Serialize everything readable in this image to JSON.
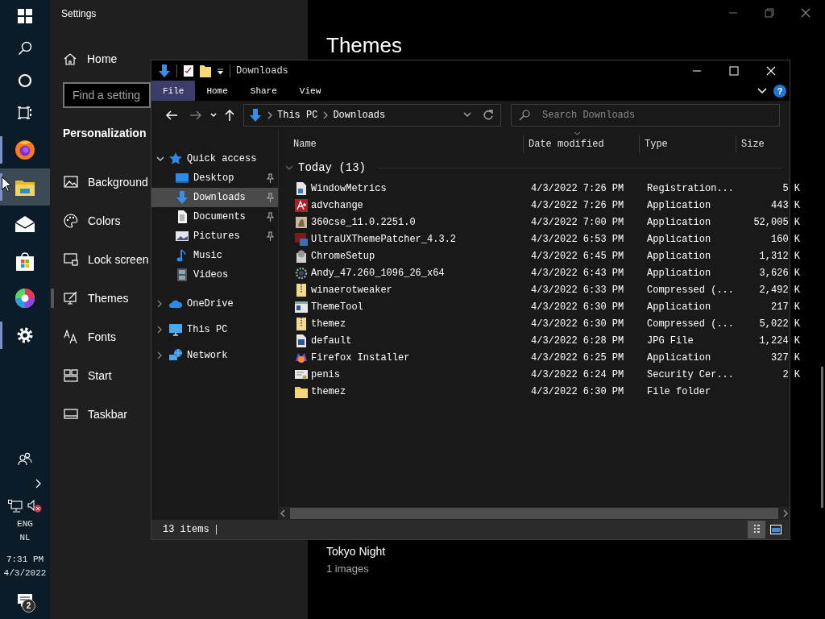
{
  "taskbar": {
    "items": [
      {
        "kind": "start",
        "running": false,
        "selected": false
      },
      {
        "kind": "search",
        "running": false,
        "selected": false
      },
      {
        "kind": "cortana",
        "running": false,
        "selected": false
      },
      {
        "kind": "taskview",
        "running": false,
        "selected": false
      },
      {
        "kind": "firefox",
        "running": true,
        "selected": false
      },
      {
        "kind": "explorer",
        "running": true,
        "selected": true
      },
      {
        "kind": "mail",
        "running": false,
        "selected": false
      },
      {
        "kind": "store",
        "running": false,
        "selected": false
      },
      {
        "kind": "photos",
        "running": false,
        "selected": false
      },
      {
        "kind": "settings",
        "running": true,
        "selected": false
      }
    ],
    "tray": {
      "language": "ENG",
      "region": "NL",
      "time": "7:31 PM",
      "date": "4/3/2022",
      "notifications": "2"
    }
  },
  "settings": {
    "title": "Settings",
    "home": "Home",
    "search": {
      "placeholder": "Find a setting"
    },
    "section": "Personalization",
    "nav": [
      {
        "kind": "background",
        "label": "Background",
        "selected": false
      },
      {
        "kind": "colors",
        "label": "Colors",
        "selected": false
      },
      {
        "kind": "lockscreen",
        "label": "Lock screen",
        "selected": false
      },
      {
        "kind": "themes",
        "label": "Themes",
        "selected": true
      },
      {
        "kind": "fonts",
        "label": "Fonts",
        "selected": false
      },
      {
        "kind": "start",
        "label": "Start",
        "selected": false
      },
      {
        "kind": "taskbar",
        "label": "Taskbar",
        "selected": false
      }
    ],
    "page_title": "Themes",
    "theme": {
      "name": "Tokyo Night",
      "count": "1 images"
    }
  },
  "explorer": {
    "title": "Downloads",
    "ribbon_tabs": [
      {
        "label": "File",
        "selected": true
      },
      {
        "label": "Home",
        "selected": false
      },
      {
        "label": "Share",
        "selected": false
      },
      {
        "label": "View",
        "selected": false
      }
    ],
    "help": "?",
    "address": [
      "This PC",
      "Downloads"
    ],
    "search": {
      "placeholder": "Search Downloads"
    },
    "tree": [
      {
        "kind": "quick",
        "label": "Quick access",
        "expanded": true,
        "selected": false,
        "children": [
          {
            "kind": "desktop",
            "label": "Desktop",
            "pinned": true,
            "selected": false
          },
          {
            "kind": "downloads",
            "label": "Downloads",
            "pinned": true,
            "selected": true
          },
          {
            "kind": "documents",
            "label": "Documents",
            "pinned": true,
            "selected": false
          },
          {
            "kind": "pictures",
            "label": "Pictures",
            "pinned": true,
            "selected": false
          },
          {
            "kind": "music",
            "label": "Music",
            "pinned": false,
            "selected": false
          },
          {
            "kind": "videos",
            "label": "Videos",
            "pinned": false,
            "selected": false
          }
        ]
      },
      {
        "kind": "cloud",
        "label": "OneDrive",
        "expanded": false,
        "selected": false
      },
      {
        "kind": "pc",
        "label": "This PC",
        "expanded": false,
        "selected": false
      },
      {
        "kind": "network",
        "label": "Network",
        "expanded": false,
        "selected": false
      }
    ],
    "columns": [
      "Name",
      "Date modified",
      "Type",
      "Size"
    ],
    "group": {
      "label": "Today (13)",
      "expanded": true
    },
    "rows": [
      {
        "kind": "registry",
        "name": "WindowMetrics",
        "date": "4/3/2022 7:26 PM",
        "type": "Registration...",
        "size": "5 K"
      },
      {
        "kind": "redapp",
        "name": "advchange",
        "date": "4/3/2022 7:26 PM",
        "type": "Application",
        "size": "443 K"
      },
      {
        "kind": "app",
        "name": "360cse_11.0.2251.0",
        "date": "4/3/2022 7:00 PM",
        "type": "Application",
        "size": "52,005 K"
      },
      {
        "kind": "patcher",
        "name": "UltraUXThemePatcher_4.3.2",
        "date": "4/3/2022 6:53 PM",
        "type": "Application",
        "size": "160 K"
      },
      {
        "kind": "installer",
        "name": "ChromeSetup",
        "date": "4/3/2022 6:45 PM",
        "type": "Application",
        "size": "1,312 K"
      },
      {
        "kind": "gear",
        "name": "Andy_47.260_1096_26_x64",
        "date": "4/3/2022 6:43 PM",
        "type": "Application",
        "size": "3,626 K"
      },
      {
        "kind": "zip",
        "name": "winaerotweaker",
        "date": "4/3/2022 6:33 PM",
        "type": "Compressed (...",
        "size": "2,492 K"
      },
      {
        "kind": "window",
        "name": "ThemeTool",
        "date": "4/3/2022 6:30 PM",
        "type": "Application",
        "size": "217 K"
      },
      {
        "kind": "zip",
        "name": "themez",
        "date": "4/3/2022 6:30 PM",
        "type": "Compressed (...",
        "size": "5,022 K"
      },
      {
        "kind": "image",
        "name": "default",
        "date": "4/3/2022 6:28 PM",
        "type": "JPG File",
        "size": "1,224 K"
      },
      {
        "kind": "fox",
        "name": "Firefox Installer",
        "date": "4/3/2022 6:25 PM",
        "type": "Application",
        "size": "327 K"
      },
      {
        "kind": "cert",
        "name": "penis",
        "date": "4/3/2022 6:24 PM",
        "type": "Security Cer...",
        "size": "2 K"
      },
      {
        "kind": "folder",
        "name": "themez",
        "date": "4/3/2022 6:30 PM",
        "type": "File folder"
      }
    ],
    "status": "13 items",
    "views": [
      {
        "kind": "details",
        "selected": true
      },
      {
        "kind": "tiles",
        "selected": false
      }
    ]
  }
}
